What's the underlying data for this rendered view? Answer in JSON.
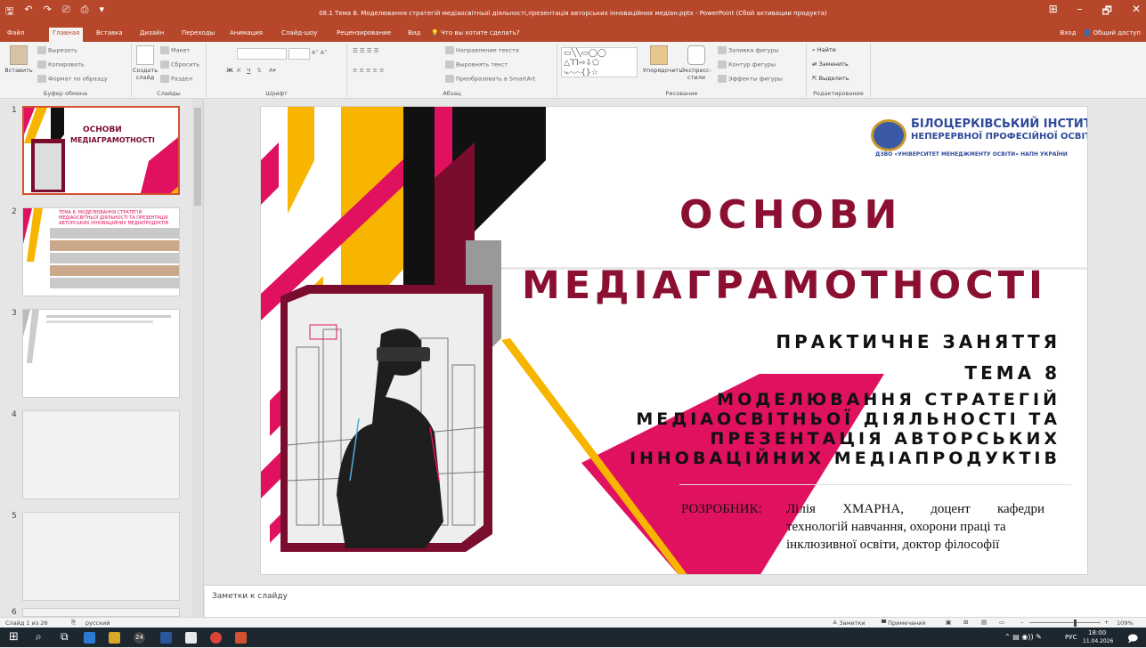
{
  "window": {
    "title": "08.1 Тема 8. Моделювання стратегій медіаосвітньої діяльності,презентація авторських інноваційних медіан.pptx - PowerPoint (Сбой активации продукта)",
    "qat": [
      "🖫",
      "↶",
      "↷",
      "⎚",
      "⎙",
      "▾"
    ],
    "controls": [
      "⊞",
      "–",
      "🗗",
      "✕"
    ]
  },
  "tabs": [
    "Файл",
    "Главная",
    "Вставка",
    "Дизайн",
    "Переходы",
    "Анимация",
    "Слайд-шоу",
    "Рецензирование",
    "Вид",
    "Что вы хотите сделать?"
  ],
  "account": {
    "signin": "Вход",
    "share": "Общий доступ"
  },
  "ribbon": {
    "clipboard": {
      "paste": "Вставить",
      "cut": "Вырезать",
      "copy": "Копировать",
      "format": "Формат по образцу",
      "label": "Буфер обмена"
    },
    "slides": {
      "new": "Создать слайд",
      "layout": "Макет",
      "reset": "Сбросить",
      "section": "Раздел",
      "label": "Слайды"
    },
    "font": {
      "bold": "Ж",
      "italic": "К",
      "underline": "Ч",
      "strike": "S",
      "label": "Шрифт"
    },
    "paragraph": {
      "direction": "Направление текста",
      "align": "Выровнять текст",
      "smartart": "Преобразовать в SmartArt",
      "label": "Абзац"
    },
    "drawing": {
      "arrange": "Упорядочить",
      "styles": "Экспресс-стили",
      "fill": "Заливка фигуры",
      "outline": "Контур фигуры",
      "effects": "Эффекты фигуры",
      "label": "Рисование"
    },
    "editing": {
      "find": "Найти",
      "replace": "Заменить",
      "select": "Выделить",
      "label": "Редактирование"
    }
  },
  "thumbnails": [
    {
      "num": "1",
      "title1": "ОСНОВИ",
      "title2": "МЕДІАГРАМОТНОСТІ"
    },
    {
      "num": "2",
      "title": "ТЕМА 8. МОДЕЛЮВАННЯ СТРАТЕГІЙ МЕДІАОСВІТНЬОЇ ДІЯЛЬНОСТІ ТА ПРЕЗЕНТАЦІЯ АВТОРСЬКИХ ІННОВАЦІЙНИХ МЕДІАПРОДУКТІВ"
    },
    {
      "num": "3"
    },
    {
      "num": "4"
    },
    {
      "num": "5"
    },
    {
      "num": "6"
    }
  ],
  "slide": {
    "logo_title": "БІЛОЦЕРКІВСЬКИЙ ІНСТИТУТ",
    "logo_subtitle": "НЕПЕРЕРВНОЇ ПРОФЕСІЙНОЇ ОСВІТИ",
    "logo_org": "ДЗВО «УНІВЕРСИТЕТ МЕНЕДЖМЕНТУ ОСВІТИ» НАПН УКРАЇНИ",
    "title1": "ОСНОВИ",
    "title2": "МЕДІАГРАМОТНОСТІ",
    "subtitle1": "ПРАКТИЧНЕ ЗАНЯТТЯ",
    "subtitle2": "ТЕМА 8",
    "topic1": "МОДЕЛЮВАННЯ СТРАТЕГІЙ",
    "topic2": "МЕДІАОСВІТНЬОЇ ДІЯЛЬНОСТІ ТА",
    "topic3": "ПРЕЗЕНТАЦІЯ АВТОРСЬКИХ",
    "topic4": "ІННОВАЦІЙНИХ МЕДІАПРОДУКТІВ",
    "author_label": "РОЗРОБНИК:",
    "author_line1": "Лілія ХМАРНА, доцент кафедри",
    "author_line2": "технологій навчання, охорони праці та",
    "author_line3": "інклюзивної освіти, доктор філософії"
  },
  "notes_placeholder": "Заметки к слайду",
  "status": {
    "slide": "Слайд 1 из 26",
    "language": "русский",
    "notes": "Заметки",
    "comments": "Примечания",
    "zoom": "109%"
  },
  "taskbar": {
    "badge": "24",
    "lang": "РУС",
    "time": "18:00",
    "date": "11.04.2026"
  },
  "colors": {
    "accent": "#b7472a",
    "magenta": "#e0115f",
    "yellow": "#f7b500",
    "maroon": "#7a0c2e",
    "black": "#111111"
  }
}
